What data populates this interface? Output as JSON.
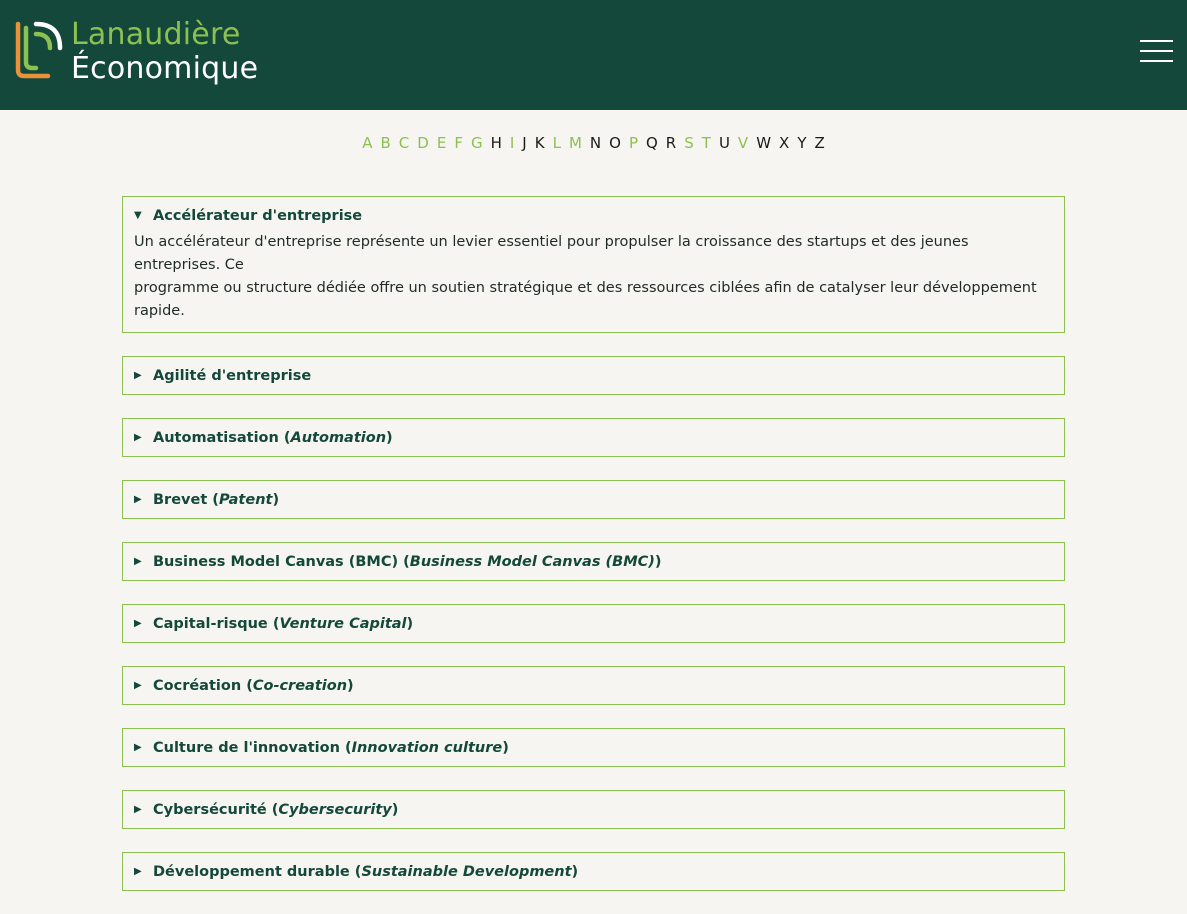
{
  "header": {
    "logo_line1": "Lanaudière",
    "logo_line2": "Économique",
    "colors": {
      "background": "#13483b",
      "accent_green": "#8cc152",
      "accent_orange": "#e8923a"
    }
  },
  "alphabet": [
    {
      "letter": "A",
      "active": true
    },
    {
      "letter": "B",
      "active": true
    },
    {
      "letter": "C",
      "active": true
    },
    {
      "letter": "D",
      "active": true
    },
    {
      "letter": "E",
      "active": true
    },
    {
      "letter": "F",
      "active": true
    },
    {
      "letter": "G",
      "active": true
    },
    {
      "letter": "H",
      "active": false
    },
    {
      "letter": "I",
      "active": true
    },
    {
      "letter": "J",
      "active": false
    },
    {
      "letter": "K",
      "active": false
    },
    {
      "letter": "L",
      "active": true
    },
    {
      "letter": "M",
      "active": true
    },
    {
      "letter": "N",
      "active": false
    },
    {
      "letter": "O",
      "active": false
    },
    {
      "letter": "P",
      "active": true
    },
    {
      "letter": "Q",
      "active": false
    },
    {
      "letter": "R",
      "active": false
    },
    {
      "letter": "S",
      "active": true
    },
    {
      "letter": "T",
      "active": true
    },
    {
      "letter": "U",
      "active": false
    },
    {
      "letter": "V",
      "active": true
    },
    {
      "letter": "W",
      "active": false
    },
    {
      "letter": "X",
      "active": false
    },
    {
      "letter": "Y",
      "active": false
    },
    {
      "letter": "Z",
      "active": false
    }
  ],
  "glossary": [
    {
      "term": "Accélérateur d'entreprise",
      "english": "",
      "open": true,
      "desc_line1": "Un accélérateur d'entreprise représente un levier essentiel pour propulser la croissance des startups et des jeunes entreprises. Ce",
      "desc_line2": "programme ou structure dédiée offre un soutien stratégique et des ressources ciblées afin de catalyser leur développement rapide."
    },
    {
      "term": "Agilité d'entreprise",
      "english": "",
      "open": false
    },
    {
      "term": "Automatisation (",
      "english": "Automation",
      "open": false
    },
    {
      "term": "Brevet (",
      "english": "Patent",
      "open": false
    },
    {
      "term": "Business Model Canvas (BMC) (",
      "english": "Business Model Canvas (BMC)",
      "open": false
    },
    {
      "term": "Capital-risque (",
      "english": "Venture Capital",
      "open": false
    },
    {
      "term": "Cocréation (",
      "english": "Co-creation",
      "open": false
    },
    {
      "term": "Culture de l'innovation (",
      "english": "Innovation culture",
      "open": false
    },
    {
      "term": "Cybersécurité (",
      "english": "Cybersecurity",
      "open": false
    },
    {
      "term": "Développement durable (",
      "english": "Sustainable Development",
      "open": false
    }
  ]
}
